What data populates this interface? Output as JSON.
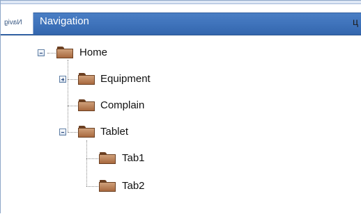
{
  "header": {
    "title": "Navigation",
    "side_tab_label": "Navig",
    "pin_icon": "pin-icon"
  },
  "tree": {
    "items": [
      {
        "label": "Home",
        "expanded": true,
        "icon": "folder-icon"
      },
      {
        "label": "Equipment",
        "expanded": false,
        "icon": "folder-icon"
      },
      {
        "label": "Complain",
        "icon": "folder-icon"
      },
      {
        "label": "Tablet",
        "expanded": true,
        "icon": "folder-icon"
      },
      {
        "label": "Tab1",
        "icon": "folder-icon"
      },
      {
        "label": "Tab2",
        "icon": "folder-icon"
      }
    ]
  },
  "colors": {
    "header_blue": "#3f73bb",
    "folder_brown": "#a8693f"
  }
}
